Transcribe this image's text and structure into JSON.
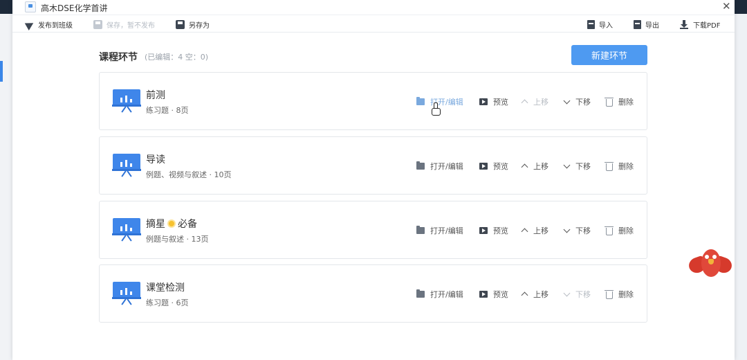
{
  "window": {
    "title": "高木DSE化学首讲"
  },
  "toolbar": {
    "publish": "发布到班级",
    "save": "保存，暂不发布",
    "save_as": "另存为",
    "import": "导入",
    "export": "导出",
    "download_pdf": "下载PDF"
  },
  "section": {
    "title": "课程环节",
    "meta": "(已编辑：4 空：0)",
    "new_button": "新建环节"
  },
  "actions": {
    "open_edit": "打开/编辑",
    "preview": "预览",
    "move_up": "上移",
    "move_down": "下移",
    "delete": "删除"
  },
  "lessons": [
    {
      "title": "前测",
      "subtitle": "练习题 · 8页"
    },
    {
      "title": "导读",
      "subtitle": "例题、视频与叙述 · 10页"
    },
    {
      "title_pre": "摘星",
      "title_post": "必备",
      "subtitle": "例题与叙述 · 13页"
    },
    {
      "title": "课堂检测",
      "subtitle": "练习题 · 6页"
    }
  ],
  "colors": {
    "primary": "#4e9af1",
    "icon_blue": "#3f86ea"
  }
}
